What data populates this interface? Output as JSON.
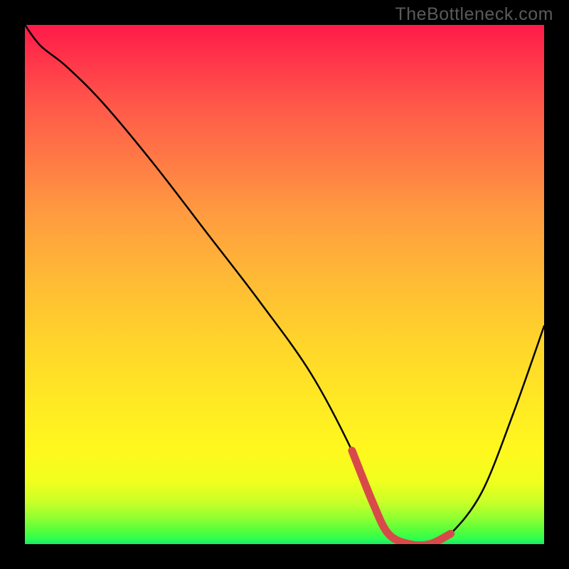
{
  "watermark": "TheBottleneck.com",
  "colors": {
    "page_bg": "#000000",
    "curve_stroke": "#000000",
    "hotzone_stroke": "#d84a4a",
    "watermark_text": "#5a5a5a"
  },
  "chart_data": {
    "type": "line",
    "title": "",
    "xlabel": "",
    "ylabel": "",
    "xlim": [
      0,
      100
    ],
    "ylim": [
      0,
      100
    ],
    "grid": false,
    "legend": false,
    "series": [
      {
        "name": "bottleneck-curve",
        "x": [
          0,
          3,
          8,
          15,
          25,
          35,
          45,
          55,
          63,
          67,
          70,
          74,
          78,
          82,
          88,
          94,
          100
        ],
        "y": [
          100,
          96,
          92,
          85,
          73,
          60,
          47,
          33,
          18,
          8,
          2,
          0,
          0,
          2,
          10,
          25,
          42
        ]
      }
    ],
    "annotations": [
      {
        "name": "optimal-zone",
        "x_start": 63,
        "x_end": 82,
        "style": "thick-red-segment"
      }
    ]
  }
}
